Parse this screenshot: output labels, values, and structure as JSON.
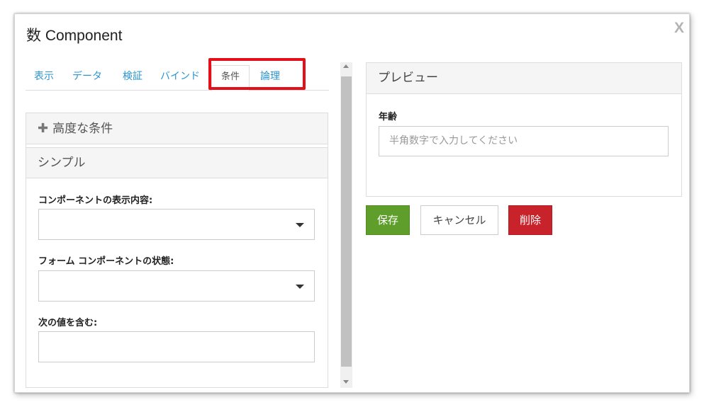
{
  "modal": {
    "title": "数 Component",
    "close_label": "X"
  },
  "tabs": [
    {
      "label": "表示"
    },
    {
      "label": "データ"
    },
    {
      "label": "検証"
    },
    {
      "label": "バインド"
    },
    {
      "label": "条件"
    },
    {
      "label": "論理"
    }
  ],
  "active_tab": "条件",
  "conditions": {
    "advanced_header": "高度な条件",
    "simple_header": "シンプル",
    "display_label": "コンポーネントの表示内容:",
    "display_value": "",
    "state_label": "フォーム コンポーネントの状態:",
    "state_value": "",
    "contains_label": "次の値を含む:",
    "contains_value": ""
  },
  "preview": {
    "header": "プレビュー",
    "age_label": "年齢",
    "age_placeholder": "半角数字で入力してください"
  },
  "actions": {
    "save": "保存",
    "cancel": "キャンセル",
    "delete": "削除"
  },
  "colors": {
    "tab_link": "#2a95d0",
    "highlight": "#e3101a",
    "save": "#5f9e2a",
    "delete": "#c8222b"
  }
}
